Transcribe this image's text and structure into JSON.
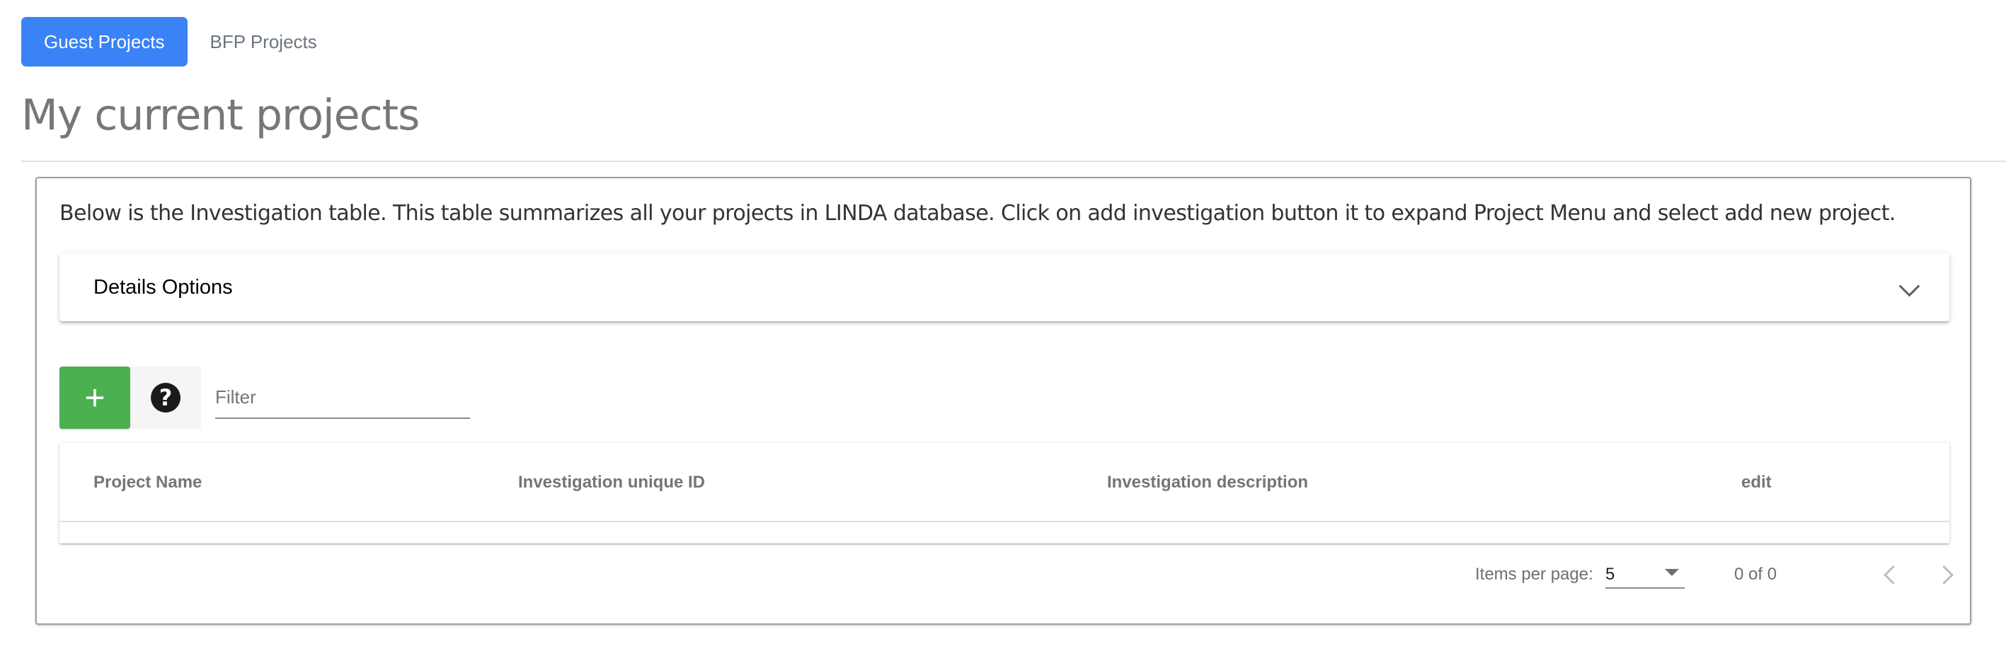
{
  "tabs": [
    {
      "label": "Guest Projects",
      "active": true
    },
    {
      "label": "BFP Projects",
      "active": false
    }
  ],
  "page_title": "My current projects",
  "intro_text": "Below is the Investigation table. This table summarizes all your projects in LINDA database. Click on add investigation button it to expand Project Menu and select add new project.",
  "details": {
    "title": "Details Options",
    "icon": "chevron-down-icon"
  },
  "toolbar": {
    "add_label": "+",
    "add_icon": "plus-icon",
    "help_label": "?",
    "help_icon": "help-circle-icon",
    "filter_placeholder": "Filter",
    "filter_value": ""
  },
  "table": {
    "columns": [
      "Project Name",
      "Investigation unique ID",
      "Investigation description",
      "edit"
    ],
    "rows": []
  },
  "paginator": {
    "items_per_page_label": "Items per page:",
    "page_size": "5",
    "range_label": "0 of 0",
    "prev_icon": "chevron-left-icon",
    "next_icon": "chevron-right-icon"
  },
  "colors": {
    "primary": "#3b82f6",
    "add_button": "#4caf50",
    "title": "#777777"
  }
}
